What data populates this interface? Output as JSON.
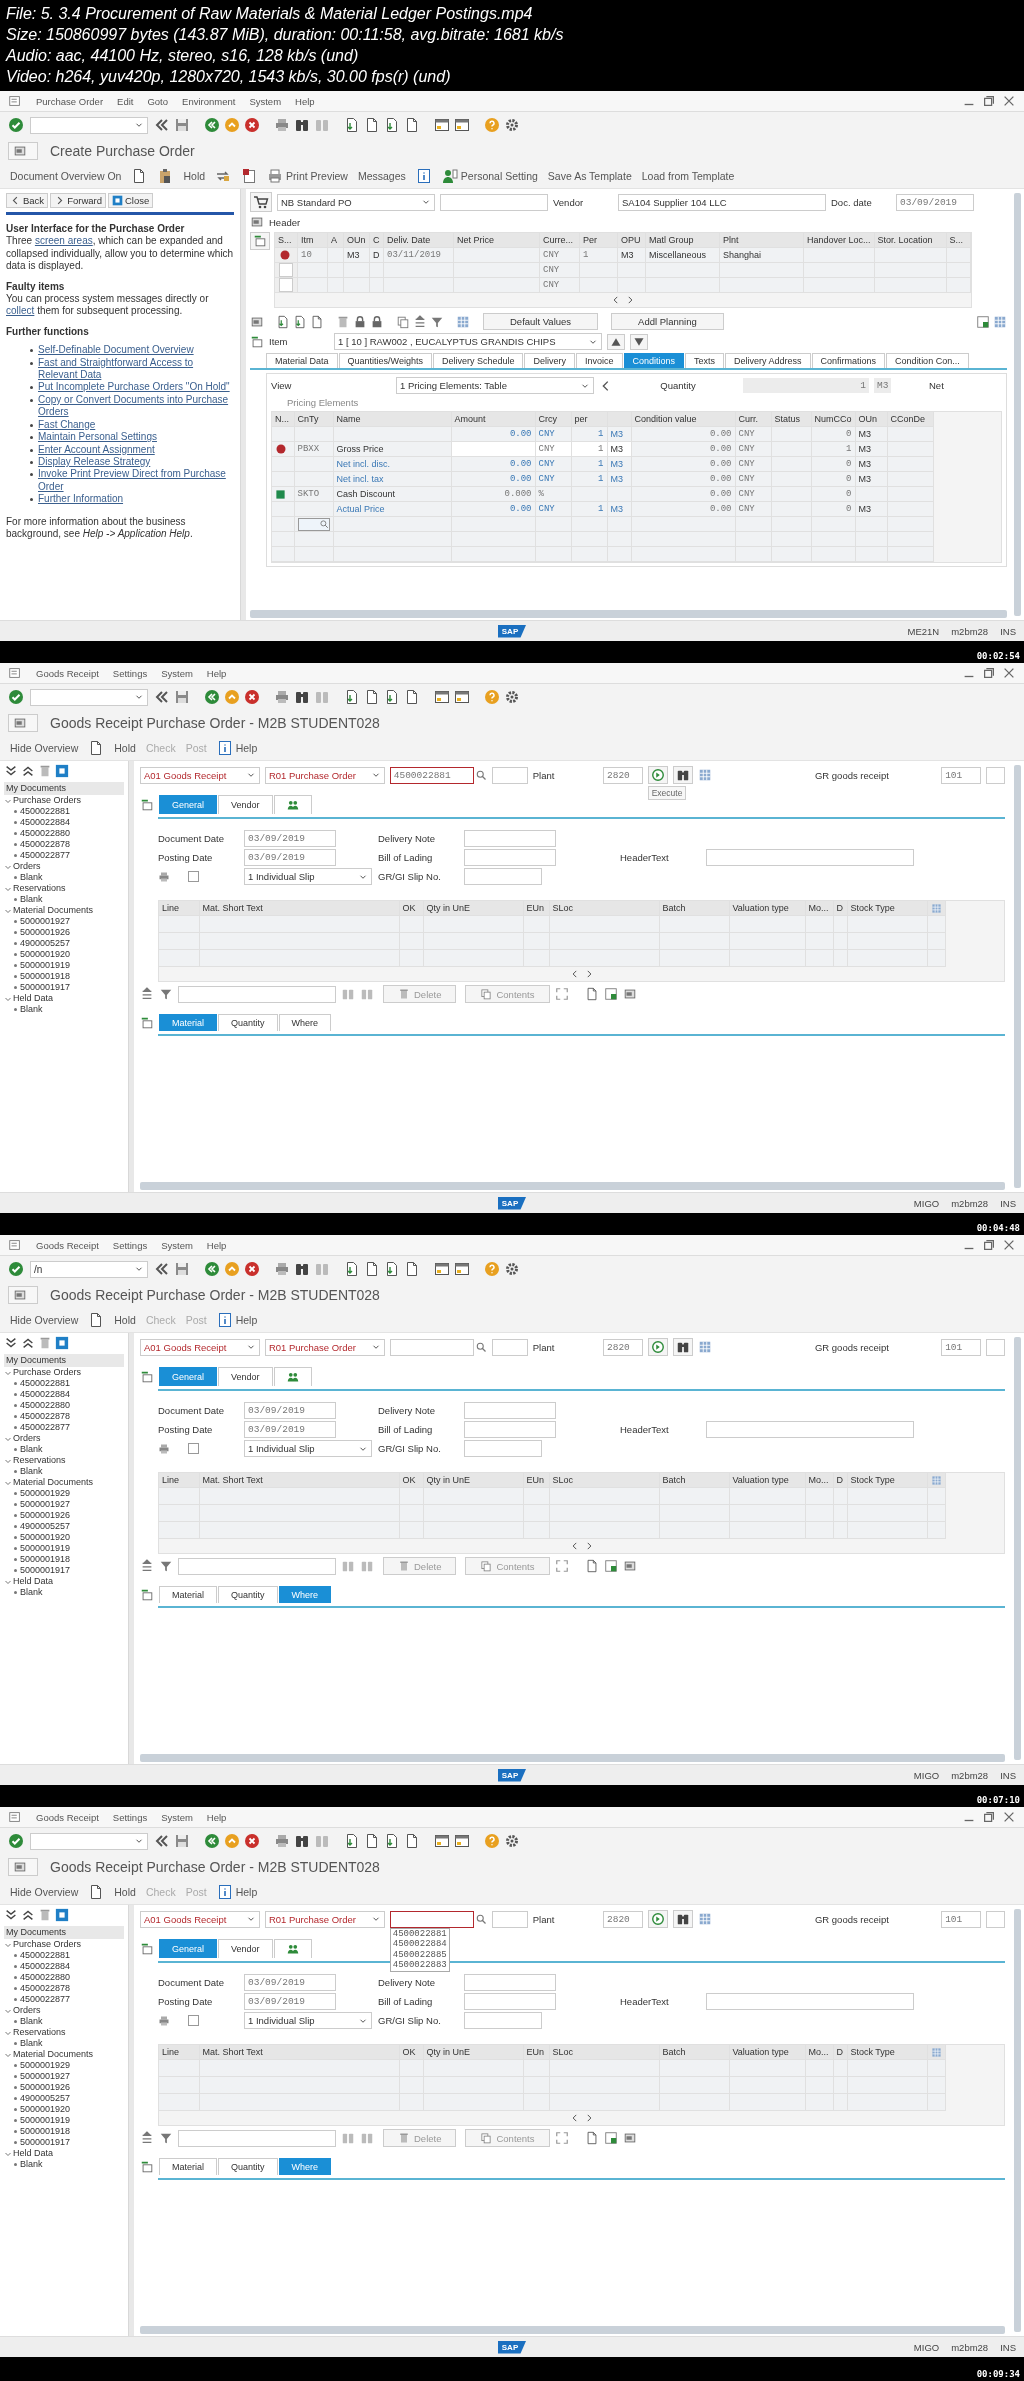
{
  "file_info": [
    "File: 5. 3.4 Procurement of Raw Materials & Material Ledger Postings.mp4",
    "Size: 150860997 bytes (143.87 MiB), duration: 00:11:58, avg.bitrate: 1681 kb/s",
    "Audio: aac, 44100 Hz, stereo, s16, 128 kb/s (und)",
    "Video: h264, yuv420p, 1280x720, 1543 kb/s, 30.00 fps(r) (und)"
  ],
  "frames": [
    {
      "kind": "po_create",
      "timestamp": "00:02:54",
      "logo": "SAP",
      "menu": [
        "Purchase Order",
        "Edit",
        "Goto",
        "Environment",
        "System",
        "Help"
      ],
      "title": "Create Purchase Order",
      "app_toolbar": [
        {
          "kind": "text",
          "label": "Document Overview On",
          "disabled": false
        },
        {
          "kind": "page",
          "disabled": false
        },
        {
          "kind": "clipboard",
          "disabled": false
        },
        {
          "kind": "text",
          "label": "Hold",
          "disabled": false
        },
        {
          "kind": "transfer",
          "disabled": false
        },
        {
          "kind": "flag",
          "disabled": false
        },
        {
          "kind": "printer",
          "label": "Print Preview",
          "disabled": false
        },
        {
          "kind": "text",
          "label": "Messages",
          "disabled": false
        },
        {
          "kind": "info",
          "disabled": false
        },
        {
          "kind": "person",
          "label": "Personal Setting",
          "disabled": false
        },
        {
          "kind": "text",
          "label": "Save As Template",
          "disabled": false
        },
        {
          "kind": "text",
          "label": "Load from Template",
          "disabled": false
        }
      ],
      "help_nav": [
        "Back",
        "Forward",
        "Close"
      ],
      "help_sections": [
        {
          "heading": "User Interface for the Purchase Order",
          "before": "Three ",
          "link": "screen areas",
          "after": ", which can be expanded and collapsed individually, allow you to determine which data is displayed."
        },
        {
          "heading": "Faulty items",
          "before": "You can process system messages directly or ",
          "link": "collect",
          "after": " them for subsequent processing."
        },
        {
          "heading": "Further functions",
          "links": [
            "Self-Definable Document Overview",
            "Fast and Straightforward Access to Relevant Data",
            "Put Incomplete Purchase Orders \"On Hold\"",
            "Copy or Convert Documents into Purchase Orders",
            "Fast Change",
            "Maintain Personal Settings",
            "Enter Account Assignment",
            "Display Release Strategy",
            "Invoke Print Preview Direct from Purchase Order",
            "Further Information"
          ]
        }
      ],
      "help_footer": "For more information about the business background, see *Help -> Application Help*.",
      "doc_type": "NB Standard PO",
      "vendor_label": "Vendor",
      "vendor": "SA104 Supplier 104 LLC",
      "doc_date_label": "Doc. date",
      "doc_date": "03/09/2019",
      "header_label": "Header",
      "items_columns": [
        "S...",
        "Itm",
        "A",
        "OUn",
        "C",
        "Deliv. Date",
        "Net Price",
        "Curre...",
        "Per",
        "OPU",
        "Matl Group",
        "Plnt",
        "Handover Loc...",
        "Stor. Location",
        "S..."
      ],
      "items_rows": [
        {
          "kind": "item",
          "itm": "10",
          "oun": "M3",
          "c": "D",
          "deliv_date": "03/11/2019",
          "currency": "CNY",
          "per": "1",
          "opu": "M3",
          "matl_group": "Miscellaneous",
          "plant": "Shanghai"
        },
        {
          "kind": "blank",
          "currency": "CNY"
        },
        {
          "kind": "blank",
          "currency": "CNY"
        }
      ],
      "items_buttons": [
        "Default Values",
        "Addl Planning"
      ],
      "item_label": "Item",
      "item_value": "1 [ 10 ] RAW002 , EUCALYPTUS GRANDIS CHIPS",
      "tabs": [
        {
          "label": "Material Data",
          "selected": false
        },
        {
          "label": "Quantities/Weights",
          "selected": false
        },
        {
          "label": "Delivery Schedule",
          "selected": false
        },
        {
          "label": "Delivery",
          "selected": false
        },
        {
          "label": "Invoice",
          "selected": false
        },
        {
          "label": "Conditions",
          "selected": true
        },
        {
          "label": "Texts",
          "selected": false
        },
        {
          "label": "Delivery Address",
          "selected": false
        },
        {
          "label": "Confirmations",
          "selected": false
        },
        {
          "label": "Condition Con...",
          "selected": false
        }
      ],
      "view_label": "View",
      "view_value": "1 Pricing Elements: Table",
      "qty_label": "Quantity",
      "qty": "1",
      "qty_unit": "M3",
      "net": "Net",
      "pricing_title": "Pricing Elements",
      "pricing_columns": [
        "N...",
        "CnTy",
        "Name",
        "Amount",
        "Crcy",
        "per",
        "Condition value",
        "Curr.",
        "Status",
        "NumCCo",
        "OUn",
        "CConDe"
      ],
      "pricing_rows": [
        {
          "kind": "base",
          "amount": "0.00",
          "crcy": "CNY",
          "per": "1",
          "per_unit": "M3",
          "cond_value": "0.00",
          "curr": "CNY",
          "numcco": "0",
          "oun": "M3"
        },
        {
          "kind": "price",
          "cnty": "PBXX",
          "name": "Gross Price",
          "crcy": "CNY",
          "per": "1",
          "per_unit": "M3",
          "cond_value": "0.00",
          "curr": "CNY",
          "numcco": "1",
          "oun": "M3"
        },
        {
          "kind": "subtotal",
          "name": "Net incl. disc.",
          "amount": "0.00",
          "crcy": "CNY",
          "per": "1",
          "per_unit": "M3",
          "cond_value": "0.00",
          "curr": "CNY",
          "numcco": "0",
          "oun": "M3"
        },
        {
          "kind": "subtotal",
          "name": "Net incl. tax",
          "amount": "0.00",
          "crcy": "CNY",
          "per": "1",
          "per_unit": "M3",
          "cond_value": "0.00",
          "curr": "CNY",
          "numcco": "0",
          "oun": "M3"
        },
        {
          "kind": "discount",
          "cnty": "SKTO",
          "name": "Cash Discount",
          "amount": "0.000",
          "crcy": "%",
          "cond_value": "0.00",
          "curr": "CNY",
          "numcco": "0"
        },
        {
          "kind": "subtotal",
          "name": "Actual Price",
          "amount": "0.00",
          "crcy": "CNY",
          "per": "1",
          "per_unit": "M3",
          "cond_value": "0.00",
          "curr": "CNY",
          "numcco": "0",
          "oun": "M3"
        },
        {
          "kind": "entry"
        }
      ],
      "status": [
        "ME21N",
        "m2bm28",
        "INS"
      ]
    },
    {
      "kind": "goods_receipt",
      "timestamp": "00:04:48",
      "logo": "SAP",
      "menu": [
        "Goods Receipt",
        "Settings",
        "System",
        "Help"
      ],
      "title": "Goods Receipt Purchase Order - M2B STUDENT028",
      "app_toolbar": [
        {
          "kind": "text",
          "label": "Hide Overview",
          "disabled": false
        },
        {
          "kind": "page",
          "disabled": false
        },
        {
          "kind": "text",
          "label": "Hold",
          "disabled": false
        },
        {
          "kind": "text",
          "label": "Check",
          "disabled": true
        },
        {
          "kind": "text",
          "label": "Post",
          "disabled": true
        },
        {
          "kind": "info",
          "label": "Help",
          "disabled": false
        }
      ],
      "tree_title": "My Documents",
      "tree": [
        {
          "label": "Purchase Orders",
          "expanded": true,
          "children": [
            {
              "label": "4500022881"
            },
            {
              "label": "4500022884"
            },
            {
              "label": "4500022880"
            },
            {
              "label": "4500022878"
            },
            {
              "label": "4500022877"
            }
          ]
        },
        {
          "label": "Orders",
          "expanded": true,
          "children": [
            {
              "label": "Blank"
            }
          ]
        },
        {
          "label": "Reservations",
          "expanded": true,
          "children": [
            {
              "label": "Blank"
            }
          ]
        },
        {
          "label": "Material Documents",
          "expanded": true,
          "children": [
            {
              "label": "5000001927"
            },
            {
              "label": "5000001926"
            },
            {
              "label": "4900005257"
            },
            {
              "label": "5000001920"
            },
            {
              "label": "5000001919"
            },
            {
              "label": "5000001918"
            },
            {
              "label": "5000001917"
            }
          ]
        },
        {
          "label": "Held Data",
          "expanded": true,
          "children": [
            {
              "label": "Blank"
            }
          ]
        }
      ],
      "action": "A01 Goods Receipt",
      "ref_doc": "R01 Purchase Order",
      "doc_number": "4500022881",
      "plant_label": "Plant",
      "plant": "2820",
      "tooltip": "Execute",
      "movement_label": "GR goods receipt",
      "movement": "101",
      "header_tabs": [
        {
          "label": "General",
          "selected": true
        },
        {
          "label": "Vendor",
          "selected": false
        }
      ],
      "doc_date_label": "Document Date",
      "doc_date": "03/09/2019",
      "posting_date_label": "Posting Date",
      "posting_date": "03/09/2019",
      "delivery_note_label": "Delivery Note",
      "bill_label": "Bill of Lading",
      "header_text_label": "HeaderText",
      "slip_label": "GR/GI Slip No.",
      "print_checked": false,
      "slip_type": "1 Individual Slip",
      "item_columns": [
        "Line",
        "Mat. Short Text",
        "OK",
        "Qty in UnE",
        "EUn",
        "SLoc",
        "Batch",
        "Valuation type",
        "Mo...",
        "D",
        "Stock Type"
      ],
      "item_toolbar": [
        "Delete",
        "Contents"
      ],
      "detail_tabs": [
        {
          "label": "Material",
          "selected": true
        },
        {
          "label": "Quantity",
          "selected": false
        },
        {
          "label": "Where",
          "selected": false
        }
      ],
      "status": [
        "MIGO",
        "m2bm28",
        "INS"
      ]
    },
    {
      "kind": "goods_receipt",
      "timestamp": "00:07:10",
      "logo": "SAP",
      "command_value": "/n",
      "menu": [
        "Goods Receipt",
        "Settings",
        "System",
        "Help"
      ],
      "title": "Goods Receipt Purchase Order - M2B STUDENT028",
      "app_toolbar": [
        {
          "kind": "text",
          "label": "Hide Overview",
          "disabled": false
        },
        {
          "kind": "page",
          "disabled": false
        },
        {
          "kind": "text",
          "label": "Hold",
          "disabled": false
        },
        {
          "kind": "text",
          "label": "Check",
          "disabled": true
        },
        {
          "kind": "text",
          "label": "Post",
          "disabled": true
        },
        {
          "kind": "info",
          "label": "Help",
          "disabled": false
        }
      ],
      "tree_title": "My Documents",
      "tree": [
        {
          "label": "Purchase Orders",
          "expanded": true,
          "children": [
            {
              "label": "4500022881"
            },
            {
              "label": "4500022884"
            },
            {
              "label": "4500022880"
            },
            {
              "label": "4500022878"
            },
            {
              "label": "4500022877"
            }
          ]
        },
        {
          "label": "Orders",
          "expanded": true,
          "children": [
            {
              "label": "Blank"
            }
          ]
        },
        {
          "label": "Reservations",
          "expanded": true,
          "children": [
            {
              "label": "Blank"
            }
          ]
        },
        {
          "label": "Material Documents",
          "expanded": true,
          "children": [
            {
              "label": "5000001929"
            },
            {
              "label": "5000001927"
            },
            {
              "label": "5000001926"
            },
            {
              "label": "4900005257"
            },
            {
              "label": "5000001920"
            },
            {
              "label": "5000001919"
            },
            {
              "label": "5000001918"
            },
            {
              "label": "5000001917"
            }
          ]
        },
        {
          "label": "Held Data",
          "expanded": true,
          "children": [
            {
              "label": "Blank"
            }
          ]
        }
      ],
      "action": "A01 Goods Receipt",
      "ref_doc": "R01 Purchase Order",
      "plant_label": "Plant",
      "plant": "2820",
      "movement_label": "GR goods receipt",
      "movement": "101",
      "header_tabs": [
        {
          "label": "General",
          "selected": true
        },
        {
          "label": "Vendor",
          "selected": false
        }
      ],
      "doc_date_label": "Document Date",
      "doc_date": "03/09/2019",
      "posting_date_label": "Posting Date",
      "posting_date": "03/09/2019",
      "delivery_note_label": "Delivery Note",
      "bill_label": "Bill of Lading",
      "header_text_label": "HeaderText",
      "slip_label": "GR/GI Slip No.",
      "print_checked": false,
      "slip_type": "1 Individual Slip",
      "item_columns": [
        "Line",
        "Mat. Short Text",
        "OK",
        "Qty in UnE",
        "EUn",
        "SLoc",
        "Batch",
        "Valuation type",
        "Mo...",
        "D",
        "Stock Type"
      ],
      "item_toolbar": [
        "Delete",
        "Contents"
      ],
      "detail_tabs": [
        {
          "label": "Material",
          "selected": false
        },
        {
          "label": "Quantity",
          "selected": false
        },
        {
          "label": "Where",
          "selected": true
        }
      ],
      "status": [
        "MIGO",
        "m2bm28",
        "INS"
      ]
    },
    {
      "kind": "goods_receipt",
      "timestamp": "00:09:34",
      "logo": "SAP",
      "menu": [
        "Goods Receipt",
        "Settings",
        "System",
        "Help"
      ],
      "title": "Goods Receipt Purchase Order - M2B STUDENT028",
      "app_toolbar": [
        {
          "kind": "text",
          "label": "Hide Overview",
          "disabled": false
        },
        {
          "kind": "page",
          "disabled": false
        },
        {
          "kind": "text",
          "label": "Hold",
          "disabled": false
        },
        {
          "kind": "text",
          "label": "Check",
          "disabled": true
        },
        {
          "kind": "text",
          "label": "Post",
          "disabled": true
        },
        {
          "kind": "info",
          "label": "Help",
          "disabled": false
        }
      ],
      "tree_title": "My Documents",
      "tree": [
        {
          "label": "Purchase Orders",
          "expanded": true,
          "children": [
            {
              "label": "4500022881"
            },
            {
              "label": "4500022884"
            },
            {
              "label": "4500022880"
            },
            {
              "label": "4500022878"
            },
            {
              "label": "4500022877"
            }
          ]
        },
        {
          "label": "Orders",
          "expanded": true,
          "children": [
            {
              "label": "Blank"
            }
          ]
        },
        {
          "label": "Reservations",
          "expanded": true,
          "children": [
            {
              "label": "Blank"
            }
          ]
        },
        {
          "label": "Material Documents",
          "expanded": true,
          "children": [
            {
              "label": "5000001929"
            },
            {
              "label": "5000001927"
            },
            {
              "label": "5000001926"
            },
            {
              "label": "4900005257"
            },
            {
              "label": "5000001920"
            },
            {
              "label": "5000001919"
            },
            {
              "label": "5000001918"
            },
            {
              "label": "5000001917"
            }
          ]
        },
        {
          "label": "Held Data",
          "expanded": true,
          "children": [
            {
              "label": "Blank"
            }
          ]
        }
      ],
      "action": "A01 Goods Receipt",
      "ref_doc": "R01 Purchase Order",
      "plant_label": "Plant",
      "plant": "2820",
      "movement_label": "GR goods receipt",
      "movement": "101",
      "dropdown": [
        "4500022881",
        "4500022884",
        "4500022885",
        "4500022883"
      ],
      "header_tabs": [
        {
          "label": "General",
          "selected": true
        },
        {
          "label": "Vendor",
          "selected": false
        }
      ],
      "doc_date_label": "Document Date",
      "doc_date": "03/09/2019",
      "posting_date_label": "Posting Date",
      "posting_date": "03/09/2019",
      "delivery_note_label": "Delivery Note",
      "bill_label": "Bill of Lading",
      "header_text_label": "HeaderText",
      "slip_label": "GR/GI Slip No.",
      "print_checked": false,
      "slip_type": "1 Individual Slip",
      "item_columns": [
        "Line",
        "Mat. Short Text",
        "OK",
        "Qty in UnE",
        "EUn",
        "SLoc",
        "Batch",
        "Valuation type",
        "Mo...",
        "D",
        "Stock Type"
      ],
      "item_toolbar": [
        "Delete",
        "Contents"
      ],
      "detail_tabs": [
        {
          "label": "Material",
          "selected": false
        },
        {
          "label": "Quantity",
          "selected": false
        },
        {
          "label": "Where",
          "selected": true
        }
      ],
      "status": [
        "MIGO",
        "m2bm28",
        "INS"
      ]
    }
  ]
}
